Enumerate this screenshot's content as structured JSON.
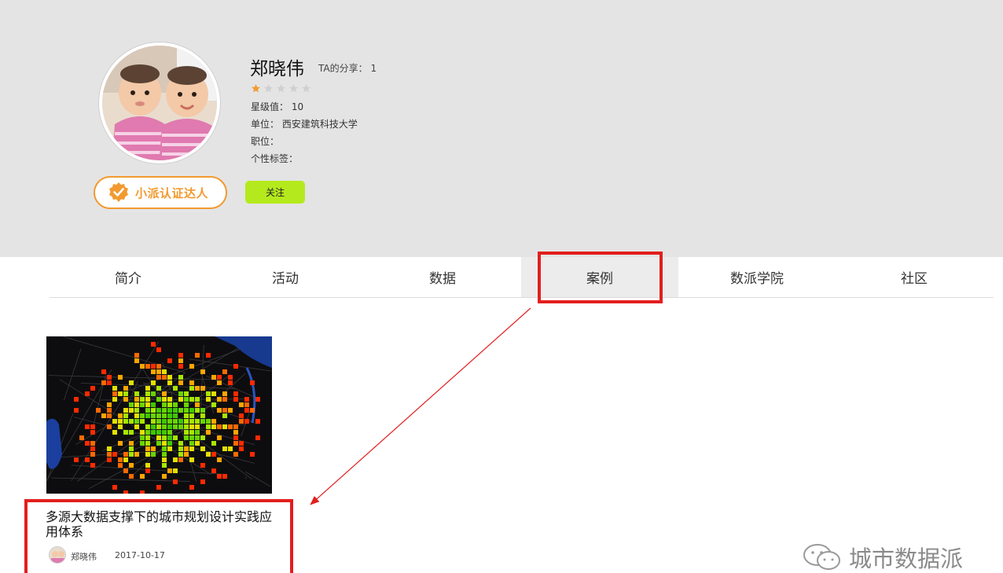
{
  "profile": {
    "name": "郑晓伟",
    "share_label": "TA的分享：",
    "share_count": "1",
    "star_rating": 1,
    "star_max": 5,
    "star_value_label": "星级值：",
    "star_value": "10",
    "unit_label": "单位：",
    "unit_value": "西安建筑科技大学",
    "position_label": "职位：",
    "position_value": "",
    "tags_label": "个性标签：",
    "tags_value": "",
    "badge_label": "小派认证达人",
    "follow_label": "关注"
  },
  "tabs": [
    {
      "label": "简介"
    },
    {
      "label": "活动"
    },
    {
      "label": "数据"
    },
    {
      "label": "案例",
      "active": true
    },
    {
      "label": "数派学院"
    },
    {
      "label": "社区"
    }
  ],
  "case_card": {
    "title": "多源大数据支撑下的城市规划设计实践应用体系",
    "author": "郑晓伟",
    "date": "2017-10-17"
  },
  "watermark": {
    "text": "城市数据派"
  },
  "colors": {
    "header_bg": "#e4e4e4",
    "accent_orange": "#f29a30",
    "follow_green": "#b4ea1d",
    "highlight_red": "#e21e1e"
  }
}
